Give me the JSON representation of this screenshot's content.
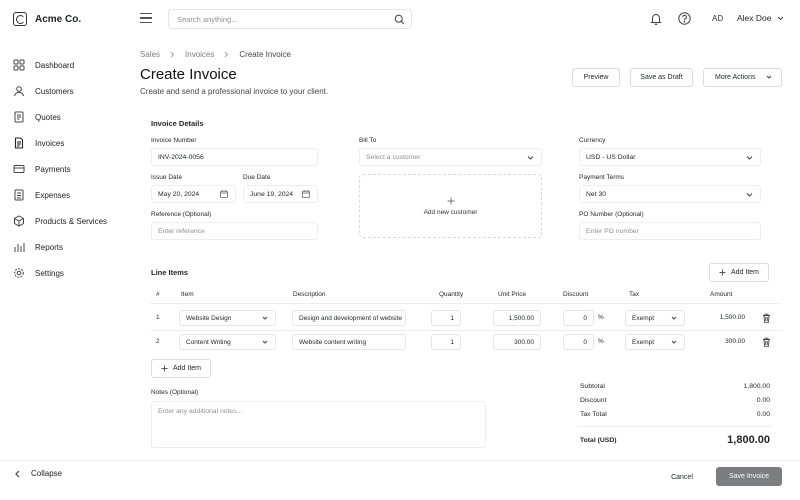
{
  "brand": {
    "name": "Acme Co."
  },
  "sidebar": {
    "items": [
      {
        "label": "Dashboard",
        "icon": "dashboard-icon"
      },
      {
        "label": "Customers",
        "icon": "customers-icon"
      },
      {
        "label": "Quotes",
        "icon": "quotes-icon"
      },
      {
        "label": "Invoices",
        "icon": "invoices-icon"
      },
      {
        "label": "Payments",
        "icon": "payments-icon"
      },
      {
        "label": "Expenses",
        "icon": "expenses-icon"
      },
      {
        "label": "Products & Services",
        "icon": "products-icon"
      },
      {
        "label": "Reports",
        "icon": "reports-icon"
      },
      {
        "label": "Settings",
        "icon": "settings-icon"
      }
    ],
    "collapse_label": "Collapse"
  },
  "topbar": {
    "search_placeholder": "Search anything...",
    "avatar_initials": "AD",
    "user_name": "Alex Doe"
  },
  "breadcrumb": [
    "Sales",
    "Invoices",
    "Create Invoice"
  ],
  "header": {
    "title": "Create Invoice",
    "subtitle": "Create and send a professional invoice to your client.",
    "preview_label": "Preview",
    "save_draft_label": "Save as Draft",
    "more_actions_label": "More Actions"
  },
  "details": {
    "section_title": "Invoice Details",
    "invoice_number_label": "Invoice Number",
    "invoice_number_value": "INV-2024-0056",
    "bill_to_label": "Bill To",
    "bill_to_placeholder": "Select a customer",
    "currency_label": "Currency",
    "currency_value": "USD - US Dollar",
    "issue_date_label": "Issue Date",
    "issue_date_value": "May 20, 2024",
    "due_date_label": "Due Date",
    "due_date_value": "June 19, 2024",
    "add_customer_label": "Add new customer",
    "payment_terms_label": "Payment Terms",
    "payment_terms_value": "Net 30",
    "reference_label": "Reference (Optional)",
    "reference_placeholder": "Enter reference",
    "po_label": "PO Number (Optional)",
    "po_placeholder": "Enter PO number"
  },
  "line_items": {
    "section_title": "Line Items",
    "add_item_top_label": "Add Item",
    "add_item_bottom_label": "Add Item",
    "columns": [
      "#",
      "Item",
      "Description",
      "Quantity",
      "Unit Price",
      "Discount",
      "Tax",
      "Amount"
    ],
    "rows": [
      {
        "num": "1",
        "item": "Website Design",
        "description": "Design and development of website",
        "quantity": "1",
        "unit_price": "1,500.00",
        "discount": "0",
        "discount_unit": "%",
        "tax": "Exempt",
        "amount": "1,500.00"
      },
      {
        "num": "2",
        "item": "Content Writing",
        "description": "Website content writing",
        "quantity": "1",
        "unit_price": "300.00",
        "discount": "0",
        "discount_unit": "%",
        "tax": "Exempt",
        "amount": "300.00"
      }
    ]
  },
  "notes": {
    "label": "Notes (Optional)",
    "placeholder": "Enter any additional notes..."
  },
  "totals": {
    "subtotal_label": "Subtotal",
    "subtotal_value": "1,800.00",
    "discount_label": "Discount",
    "discount_value": "0.00",
    "tax_label": "Tax Total",
    "tax_value": "0.00",
    "total_label": "Total (USD)",
    "total_value": "1,800.00"
  },
  "footer": {
    "cancel_label": "Cancel",
    "save_label": "Save Invoice"
  },
  "colors": {
    "primary_button": "#7b7d80",
    "border": "#e3e5e8",
    "text": "#1f2328",
    "muted": "#8b9098"
  }
}
